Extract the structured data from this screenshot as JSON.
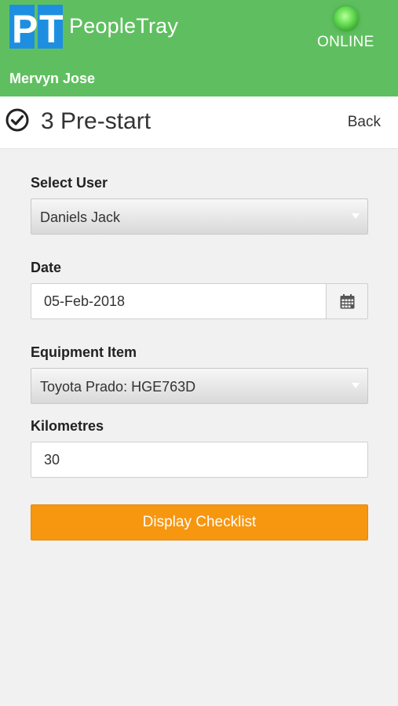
{
  "header": {
    "logo_text": "PT",
    "brand_name": "PeopleTray",
    "status_text": "ONLINE",
    "status_color": "#6ee35a",
    "user_name": "Mervyn Jose",
    "background_color": "#5fbf60"
  },
  "title_bar": {
    "icon": "check-circle-icon",
    "title": "3 Pre-start",
    "back_label": "Back"
  },
  "form": {
    "select_user": {
      "label": "Select User",
      "value": "Daniels Jack"
    },
    "date": {
      "label": "Date",
      "value": "05-Feb-2018",
      "icon": "calendar-icon"
    },
    "equipment_item": {
      "label": "Equipment Item",
      "value": "Toyota Prado: HGE763D"
    },
    "kilometres": {
      "label": "Kilometres",
      "value": "30"
    },
    "submit_label": "Display Checklist",
    "accent_color": "#f7960f"
  }
}
